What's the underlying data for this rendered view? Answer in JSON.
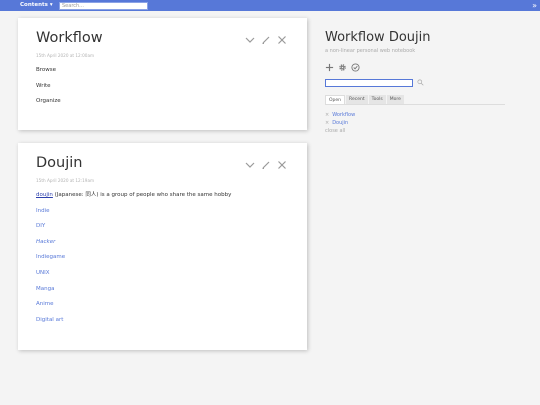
{
  "topbar": {
    "contents_label": "Contents",
    "search_placeholder": "Search...",
    "fold_icon": "double-chevron-right-icon"
  },
  "tiddlers": [
    {
      "title": "Workflow",
      "subtitle": "15th April 2020 at 12:00am",
      "lines": [
        "Browse",
        "Write",
        "Organize"
      ]
    },
    {
      "title": "Doujin",
      "subtitle": "15th April 2020 at 12:19am",
      "intro_link": "doujin",
      "intro_text": " (Japanese: 同人) is a group of people who share the same hobby",
      "links": [
        "Indie",
        "DIY",
        "Hacker",
        "Indiegame",
        "UNIX",
        "Manga",
        "Anime",
        "Digital art"
      ]
    }
  ],
  "sidebar": {
    "title": "Workflow Doujin",
    "subtitle": "a non-linear personal web notebook",
    "tabs": [
      "Open",
      "Recent",
      "Tools",
      "More"
    ],
    "open_items": [
      "Workflow",
      "Doujin"
    ],
    "close_all": "close all"
  },
  "colors": {
    "accent": "#5778d8",
    "background": "#f4f4f4"
  }
}
